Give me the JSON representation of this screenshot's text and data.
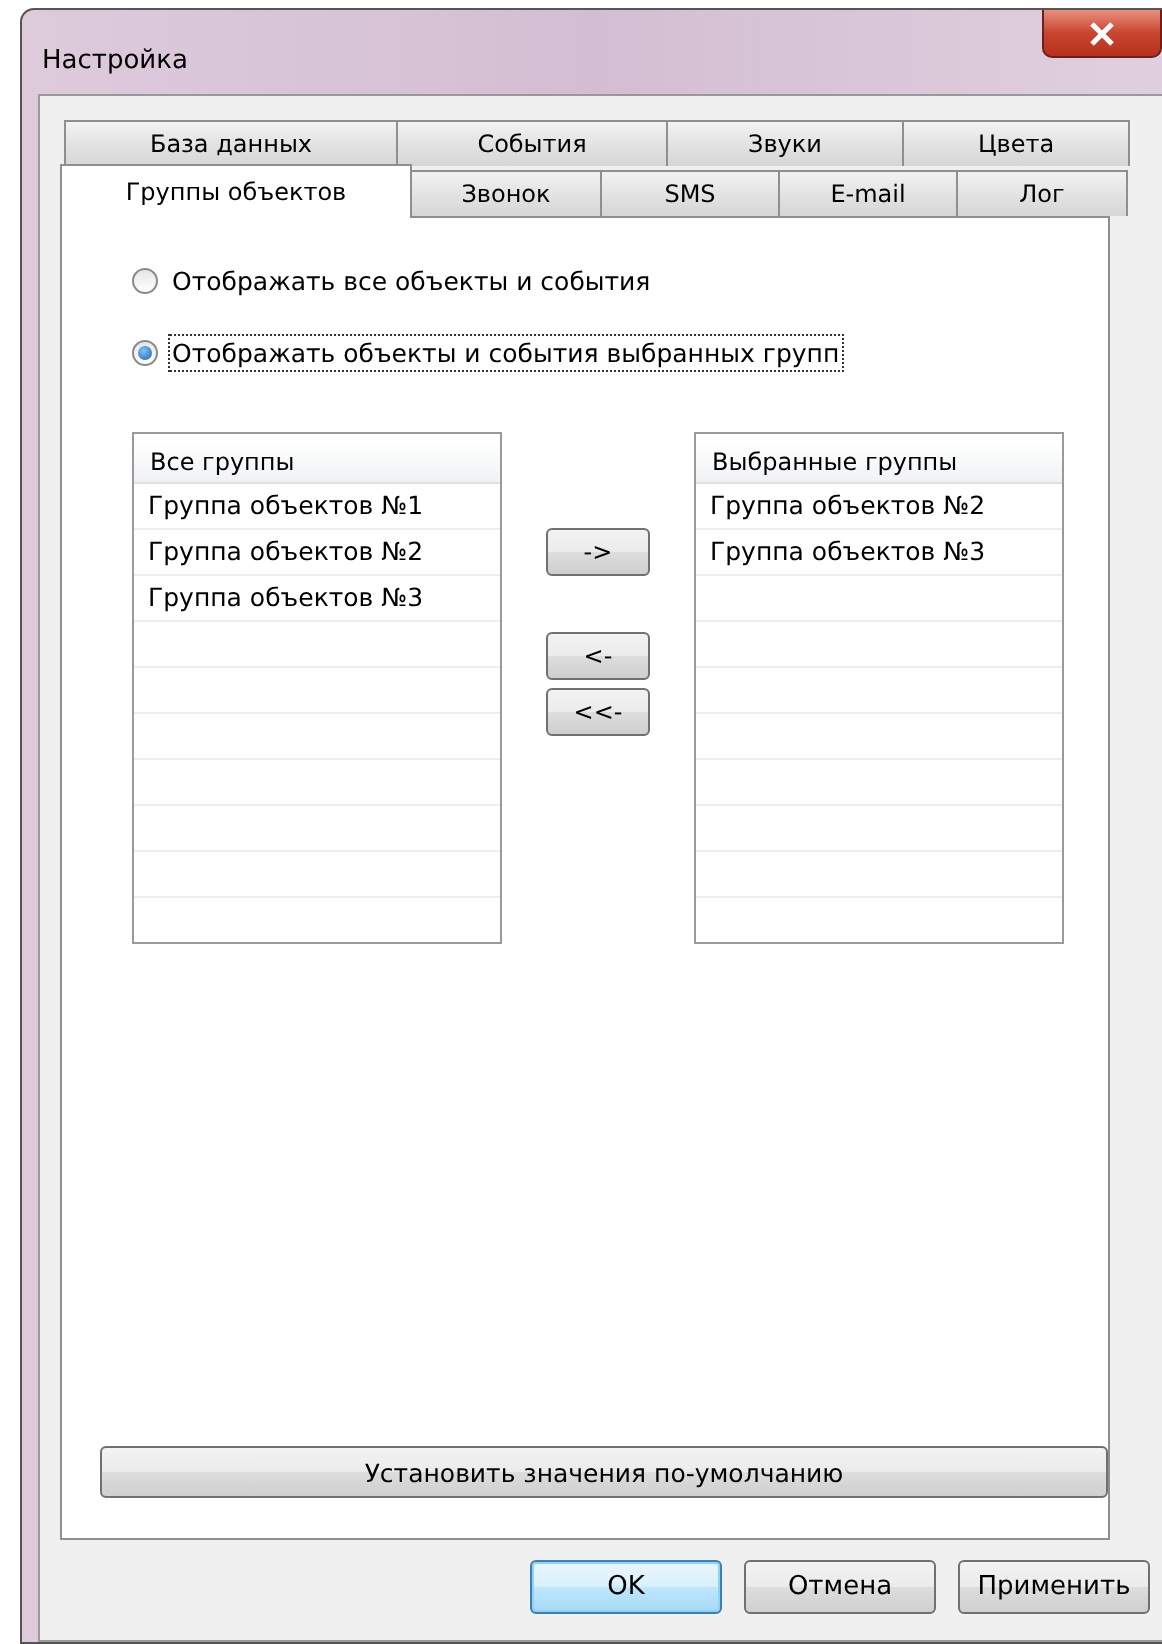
{
  "window": {
    "title": "Настройка"
  },
  "tab_rows": [
    [
      {
        "label": "База данных",
        "selected": false
      },
      {
        "label": "События",
        "selected": false
      },
      {
        "label": "Звуки",
        "selected": false
      },
      {
        "label": "Цвета",
        "selected": false
      }
    ],
    [
      {
        "label": "Группы объектов",
        "selected": true
      },
      {
        "label": "Звонок",
        "selected": false
      },
      {
        "label": "SMS",
        "selected": false
      },
      {
        "label": "E-mail",
        "selected": false
      },
      {
        "label": "Лог",
        "selected": false
      }
    ]
  ],
  "radios": [
    {
      "label": "Отображать все объекты и события",
      "selected": false
    },
    {
      "label": "Отображать объекты и события выбранных групп",
      "selected": true
    }
  ],
  "all_groups": {
    "header": "Все группы",
    "items": [
      "Группа объектов №1",
      "Группа объектов №2",
      "Группа объектов №3"
    ]
  },
  "move_buttons": [
    "->",
    "<-",
    "<<-"
  ],
  "selected_groups": {
    "header": "Выбранные группы",
    "items": [
      "Группа объектов №2",
      "Группа объектов №3"
    ]
  },
  "defaults_button": "Установить значения по-умолчанию",
  "buttons": [
    {
      "label": "OK",
      "kind": "default"
    },
    {
      "label": "Отмена",
      "kind": "normal"
    },
    {
      "label": "Применить",
      "kind": "normal"
    }
  ]
}
